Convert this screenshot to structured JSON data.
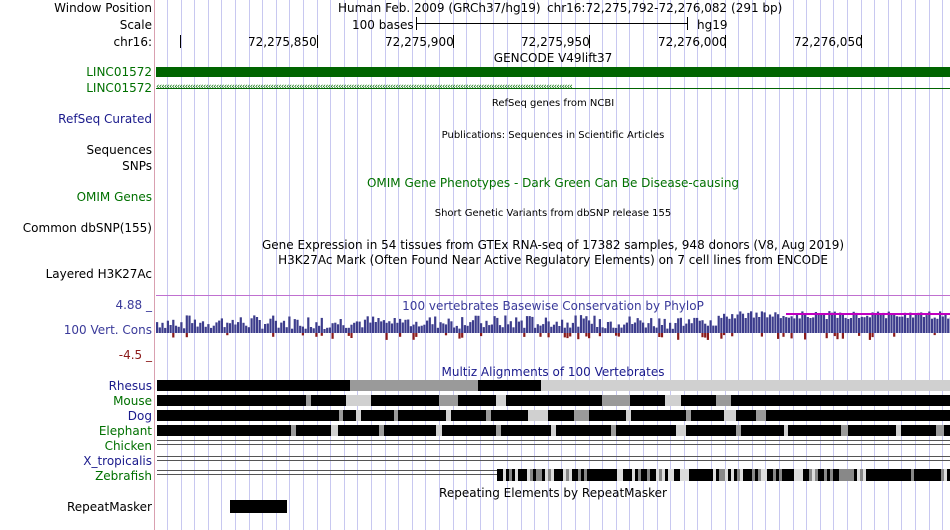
{
  "header": {
    "window_position_label": "Window Position",
    "scale_label": "Scale",
    "chrom_label": "chr16:",
    "assembly_text": "Human Feb. 2009 (GRCh37/hg19)",
    "position_text": "chr16:72,275,792-72,276,082 (291 bp)",
    "scale_text": "100 bases",
    "db": "hg19",
    "ticks": [
      "72,275,850",
      "72,275,900",
      "72,275,950",
      "72,276,000",
      "72,276,050"
    ]
  },
  "tracks": {
    "gencode": {
      "title": "GENCODE V49lift37",
      "label1": "LINC01572",
      "label2": "LINC01572"
    },
    "refseq": {
      "title": "RefSeq genes from NCBI",
      "label": "RefSeq Curated"
    },
    "publications": {
      "title": "Publications: Sequences in Scientific Articles",
      "label": "Sequences"
    },
    "snps_label": "SNPs",
    "omim": {
      "title": "OMIM Gene Phenotypes - Dark Green Can Be Disease-causing",
      "label": "OMIM Genes"
    },
    "dbsnp": {
      "title": "Short Genetic Variants from dbSNP release 155",
      "label": "Common dbSNP(155)"
    },
    "gtex": {
      "title": "Gene Expression in 54 tissues from GTEx RNA-seq of 17382 samples, 948 donors (V8, Aug 2019)"
    },
    "h3k27ac": {
      "title": "H3K27Ac Mark (Often Found Near Active Regulatory Elements) on 7 cell lines from ENCODE",
      "label": "Layered H3K27Ac"
    },
    "cons": {
      "title": "100 vertebrates Basewise Conservation by PhyloP",
      "label": "100 Vert. Cons",
      "max": "4.88 _",
      "min": "-4.5 _"
    },
    "multiz": {
      "title": "Multiz Alignments of 100 Vertebrates",
      "species": [
        "Rhesus",
        "Mouse",
        "Dog",
        "Elephant",
        "Chicken",
        "X_tropicalis",
        "Zebrafish"
      ]
    },
    "repeatmasker": {
      "title": "Repeating Elements by RepeatMasker",
      "label": "RepeatMasker"
    }
  },
  "colors": {
    "gencode": "#006400",
    "cons_pos": "#3c3c8c",
    "cons_neg": "#8b1a1a",
    "conserved": "#c000c0"
  }
}
